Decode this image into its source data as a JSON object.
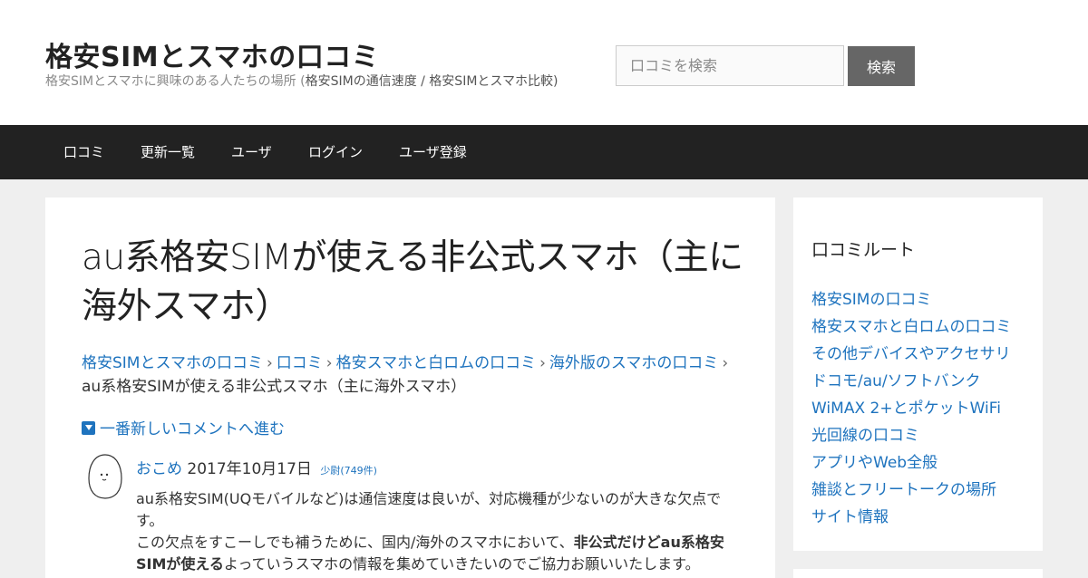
{
  "header": {
    "site_title": "格安SIMとスマホの口コミ",
    "site_desc_main": "格安SIMとスマホに興味のある人たちの場所 (",
    "site_desc_paren": "格安SIMの通信速度 / 格安SIMとスマホ比較)",
    "search_placeholder": "口コミを検索",
    "search_button": "検索"
  },
  "nav": {
    "items": [
      {
        "label": "口コミ"
      },
      {
        "label": "更新一覧"
      },
      {
        "label": "ユーザ"
      },
      {
        "label": "ログイン"
      },
      {
        "label": "ユーザ登録"
      }
    ]
  },
  "main": {
    "title": "au系格安SIMが使える非公式スマホ（主に海外スマホ）",
    "breadcrumb": {
      "items": [
        {
          "label": "格安SIMとスマホの口コミ"
        },
        {
          "label": "口コミ"
        },
        {
          "label": "格安スマホと白ロムの口コミ"
        },
        {
          "label": "海外版のスマホの口コミ"
        }
      ],
      "separator": "›",
      "current": "au系格安SIMが使える非公式スマホ（主に海外スマホ）"
    },
    "jump_link": "一番新しいコメントへ進む",
    "comment": {
      "author": "おこめ",
      "date": "2017年10月17日",
      "rank": "少尉(749件)",
      "line1": "au系格安SIM(UQモバイルなど)は通信速度は良いが、対応機種が少ないのが大きな欠点です。",
      "line2_start": "この欠点をすこーしでも補うために、国内/海外のスマホにおいて、",
      "line2_bold": "非公式だけどau系格安SIMが使える",
      "line2_end": "よっていうスマホの情報を集めていきたいのでご協力お願いいたします。"
    }
  },
  "sidebar": {
    "title": "口コミルート",
    "items": [
      {
        "label": "格安SIMの口コミ"
      },
      {
        "label": "格安スマホと白ロムの口コミ"
      },
      {
        "label": "その他デバイスやアクセサリ"
      },
      {
        "label": "ドコモ/au/ソフトバンク"
      },
      {
        "label": "WiMAX 2+とポケットWiFi"
      },
      {
        "label": "光回線の口コミ"
      },
      {
        "label": "アプリやWeb全般"
      },
      {
        "label": "雑談とフリートークの場所"
      },
      {
        "label": "サイト情報"
      }
    ]
  },
  "colors": {
    "link": "#1e73be",
    "nav_bg": "#222222",
    "page_bg": "#efefef",
    "search_button_bg": "#666666"
  }
}
